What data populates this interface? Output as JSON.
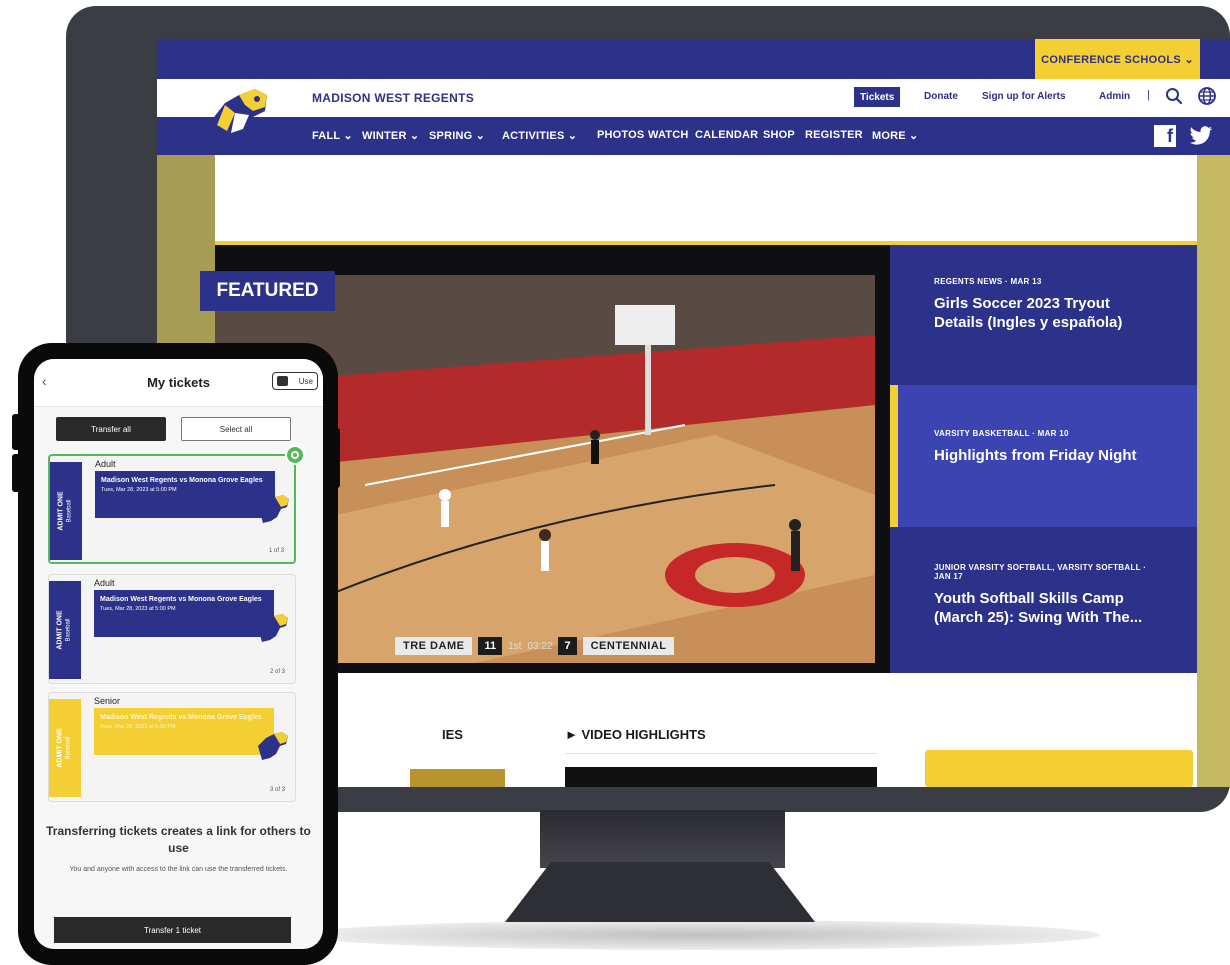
{
  "site": {
    "conference_button": "CONFERENCE SCHOOLS ⌄",
    "brand": "MADISON WEST REGENTS",
    "top_links": {
      "tickets": "Tickets",
      "donate": "Donate",
      "alerts": "Sign up for Alerts",
      "admin": "Admin",
      "separator": "|"
    },
    "nav": [
      "FALL ⌄",
      "WINTER ⌄",
      "SPRING ⌄",
      "ACTIVITIES ⌄",
      "PHOTOS",
      "WATCH",
      "CALENDAR",
      "SHOP",
      "REGISTER",
      "MORE ⌄"
    ],
    "featured_label": "FEATURED",
    "scoreboard": {
      "home": "TRE DAME",
      "home_score": "11",
      "period": "1st",
      "clock": "03:22",
      "away_score": "7",
      "away": "CENTENNIAL"
    },
    "news": [
      {
        "meta": "REGENTS NEWS · MAR 13",
        "title": "Girls Soccer 2023 Tryout Details (Ingles y española)"
      },
      {
        "meta": "VARSITY BASKETBALL · MAR 10",
        "title": "Highlights from Friday Night"
      },
      {
        "meta": "JUNIOR VARSITY SOFTBALL, VARSITY SOFTBALL · JAN 17",
        "title": "Youth Softball Skills Camp (March 25): Swing With The..."
      }
    ],
    "games_label": "IES",
    "video_highlights_label": "► VIDEO HIGHLIGHTS"
  },
  "phone": {
    "back": "‹",
    "title": "My tickets",
    "use_button": "Use",
    "transfer_all": "Transfer all",
    "select_all": "Select all",
    "tickets": [
      {
        "type": "Adult",
        "side": "ADMIT ONE",
        "side_sub": "Baseball",
        "match": "Madison West Regents vs Monona Grove Eagles",
        "date": "Tues, Mar 28, 2023 at 5:00 PM",
        "count": "1 of 3"
      },
      {
        "type": "Adult",
        "side": "ADMIT ONE",
        "side_sub": "Baseball",
        "match": "Madison West Regents vs Monona Grove Eagles",
        "date": "Tues, Mar 28, 2023 at 5:00 PM",
        "count": "2 of 3"
      },
      {
        "type": "Senior",
        "side": "ADMIT ONE",
        "side_sub": "Baseball",
        "match": "Madison West Regents vs Monona Grove Eagles",
        "date": "Tues, Mar 28, 2023 at 5:00 PM",
        "count": "3 of 3"
      }
    ],
    "heading": "Transferring tickets creates a link for others to use",
    "subtext": "You and anyone with access to the link can use the transferred tickets.",
    "bottom_button": "Transfer 1 ticket"
  },
  "colors": {
    "brand_blue": "#2c3189",
    "brand_gold": "#f3cf34",
    "active_blue": "#3b44b1",
    "selected_green": "#56b85d"
  }
}
